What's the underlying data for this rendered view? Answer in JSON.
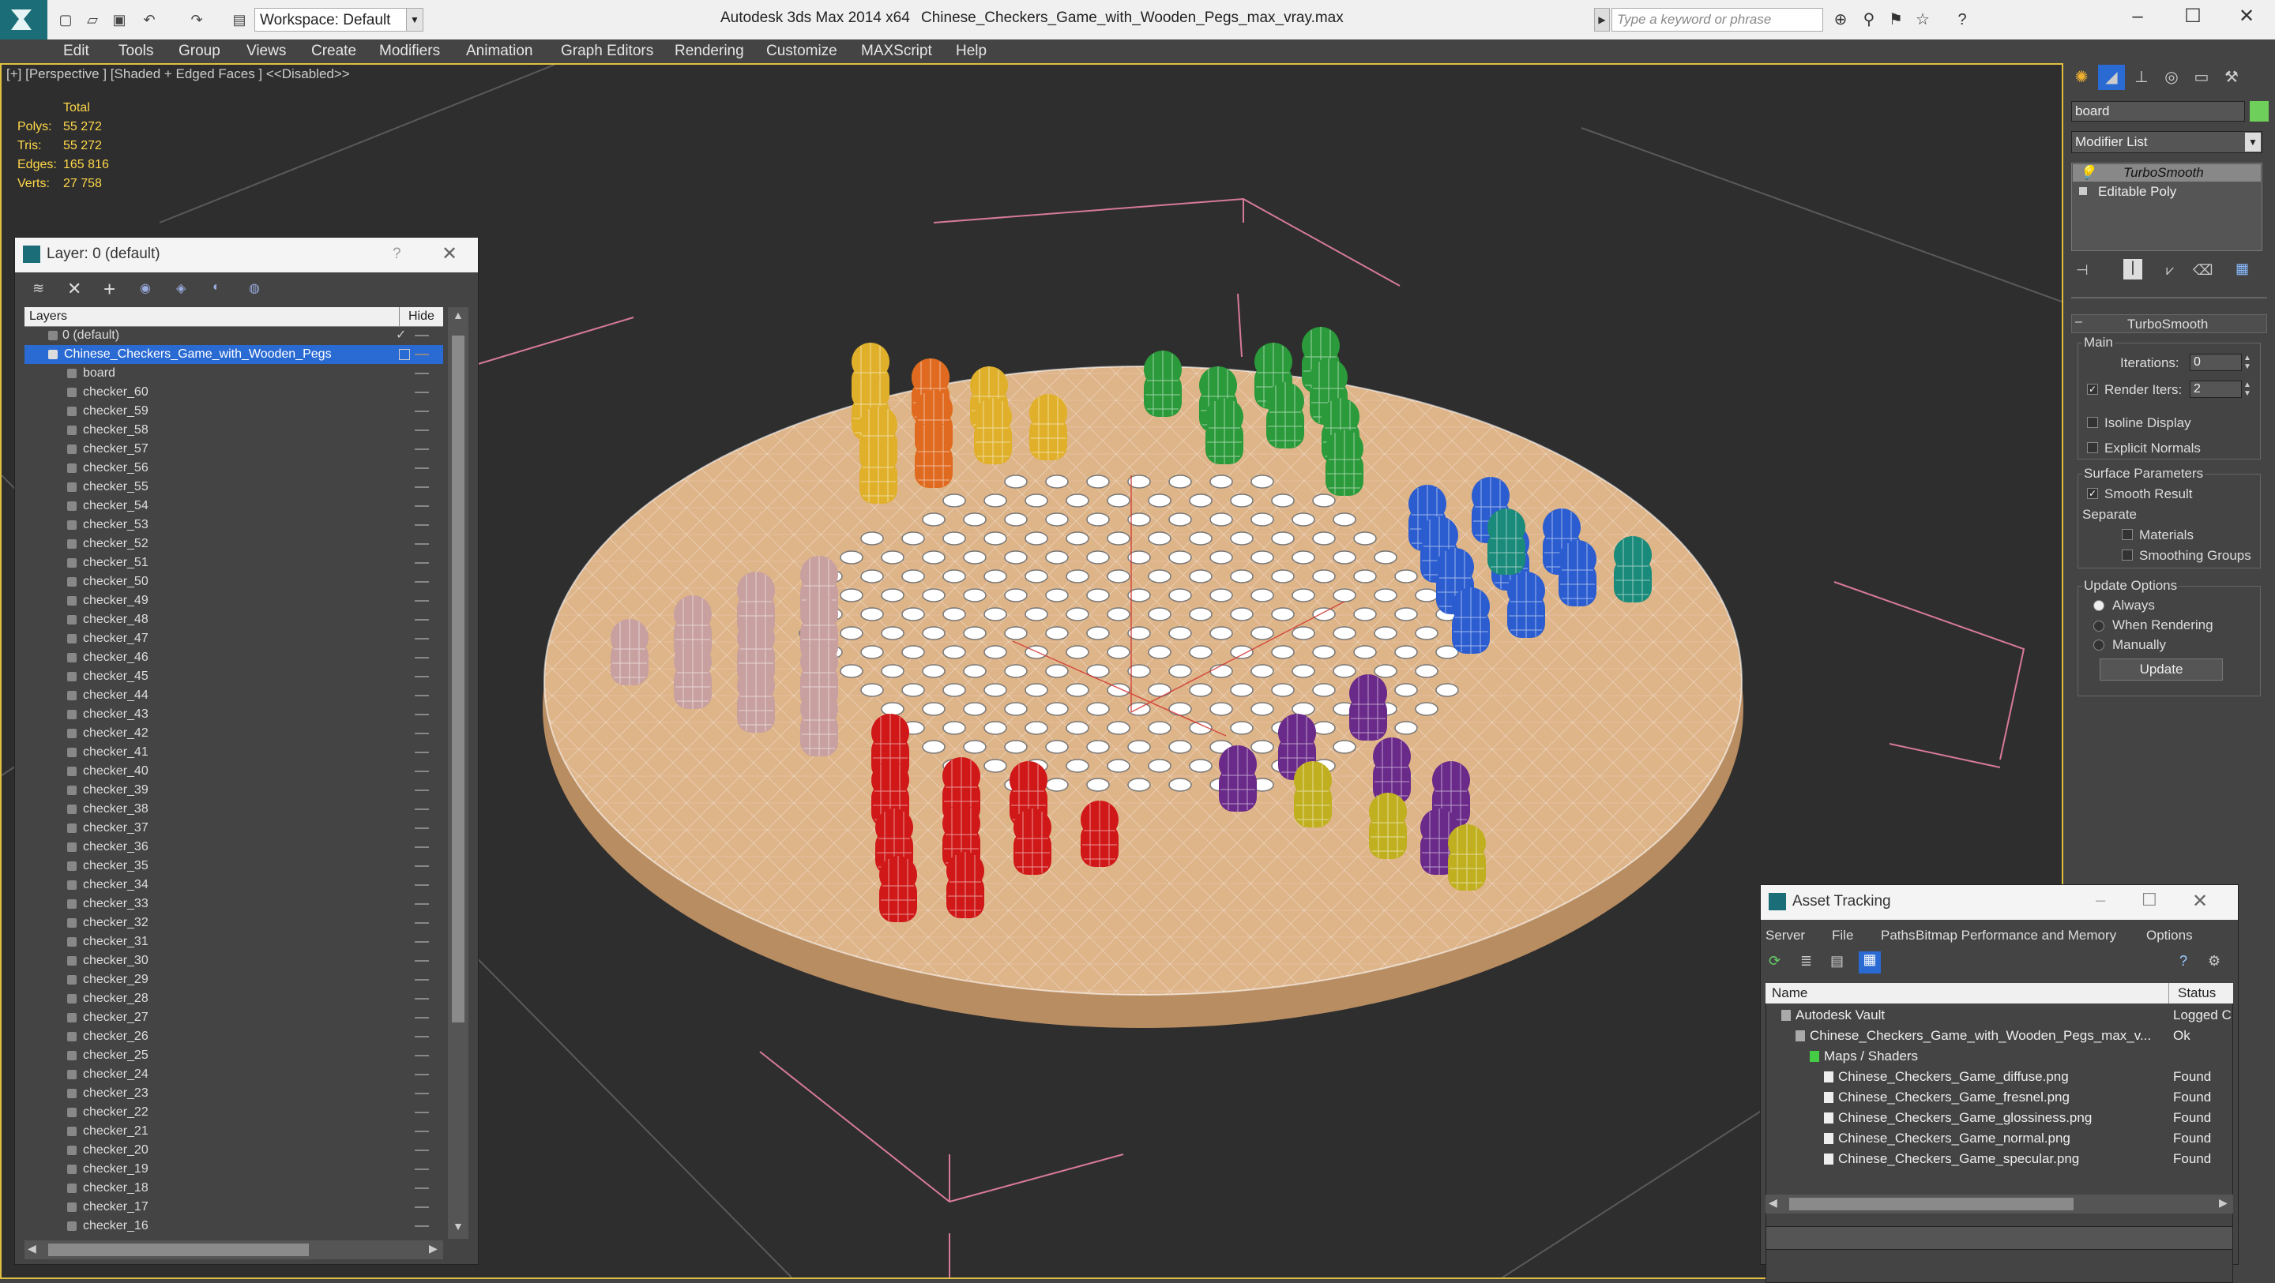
{
  "titlebar": {
    "workspace": "Workspace: Default",
    "app_title": "Autodesk 3ds Max  2014 x64",
    "file_title": "Chinese_Checkers_Game_with_Wooden_Pegs_max_vray.max",
    "search_placeholder": "Type a keyword or phrase"
  },
  "menu": [
    "Edit",
    "Tools",
    "Group",
    "Views",
    "Create",
    "Modifiers",
    "Animation",
    "Graph Editors",
    "Rendering",
    "Customize",
    "MAXScript",
    "Help"
  ],
  "viewport": {
    "label": "[+] [Perspective ] [Shaded + Edged Faces ]  <<Disabled>>",
    "stats": {
      "total_label": "Total",
      "rows": [
        {
          "label": "Polys:",
          "value": "55 272"
        },
        {
          "label": "Tris:",
          "value": "55 272"
        },
        {
          "label": "Edges:",
          "value": "165 816"
        },
        {
          "label": "Verts:",
          "value": "27 758"
        }
      ]
    }
  },
  "layer_dialog": {
    "title": "Layer: 0 (default)",
    "help": "?",
    "col_layers": "Layers",
    "col_hide": "Hide",
    "top_rows": [
      "0 (default)",
      "Chinese_Checkers_Game_with_Wooden_Pegs"
    ],
    "children": [
      "board",
      "checker_60",
      "checker_59",
      "checker_58",
      "checker_57",
      "checker_56",
      "checker_55",
      "checker_54",
      "checker_53",
      "checker_52",
      "checker_51",
      "checker_50",
      "checker_49",
      "checker_48",
      "checker_47",
      "checker_46",
      "checker_45",
      "checker_44",
      "checker_43",
      "checker_42",
      "checker_41",
      "checker_40",
      "checker_39",
      "checker_38",
      "checker_37",
      "checker_36",
      "checker_35",
      "checker_34",
      "checker_33",
      "checker_32",
      "checker_31",
      "checker_30",
      "checker_29",
      "checker_28",
      "checker_27",
      "checker_26",
      "checker_25",
      "checker_24",
      "checker_23",
      "checker_22",
      "checker_21",
      "checker_20",
      "checker_19",
      "checker_18",
      "checker_17",
      "checker_16"
    ]
  },
  "command_panel": {
    "object_name": "board",
    "modifier_list": "Modifier List",
    "stack": [
      "TurboSmooth",
      "Editable Poly"
    ],
    "rollout_title": "TurboSmooth",
    "main_label": "Main",
    "iterations_label": "Iterations:",
    "iterations_value": "0",
    "render_iters_label": "Render Iters:",
    "render_iters_value": "2",
    "isoline": "Isoline Display",
    "explicit": "Explicit Normals",
    "surface_params": "Surface Parameters",
    "smooth_result": "Smooth Result",
    "separate": "Separate",
    "materials": "Materials",
    "smoothing_groups": "Smoothing Groups",
    "update_options": "Update Options",
    "always": "Always",
    "when_rendering": "When Rendering",
    "manually": "Manually",
    "update_btn": "Update"
  },
  "asset_dialog": {
    "title": "Asset Tracking",
    "menu": [
      "Server",
      "File",
      "Paths",
      "Bitmap Performance and Memory",
      "Options"
    ],
    "col_name": "Name",
    "col_status": "Status",
    "rows": [
      {
        "name": "Autodesk Vault",
        "status": "Logged C",
        "indent": 0
      },
      {
        "name": "Chinese_Checkers_Game_with_Wooden_Pegs_max_v...",
        "status": "Ok",
        "indent": 1
      },
      {
        "name": "Maps / Shaders",
        "status": "",
        "indent": 2
      },
      {
        "name": "Chinese_Checkers_Game_diffuse.png",
        "status": "Found",
        "indent": 3
      },
      {
        "name": "Chinese_Checkers_Game_fresnel.png",
        "status": "Found",
        "indent": 3
      },
      {
        "name": "Chinese_Checkers_Game_glossiness.png",
        "status": "Found",
        "indent": 3
      },
      {
        "name": "Chinese_Checkers_Game_normal.png",
        "status": "Found",
        "indent": 3
      },
      {
        "name": "Chinese_Checkers_Game_specular.png",
        "status": "Found",
        "indent": 3
      }
    ]
  },
  "colors": {
    "accent": "#2a6ad3",
    "viewport_border": "#e0c040",
    "stats_text": "#ffd84a",
    "wood": "#d9a878"
  }
}
